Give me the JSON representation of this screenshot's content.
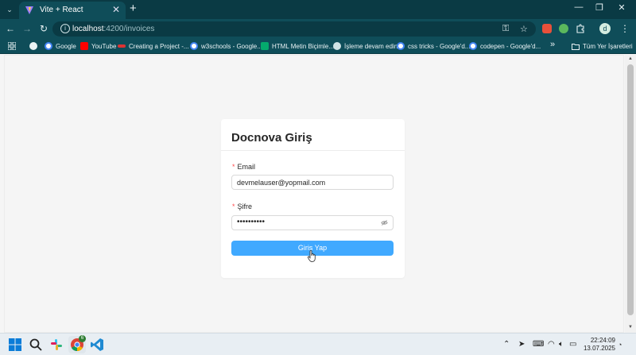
{
  "tab": {
    "title": "Vite + React",
    "close": "✕"
  },
  "new_tab": "+",
  "window": {
    "minimize": "—",
    "restore": "❐",
    "close": "✕"
  },
  "address": {
    "host": "localhost",
    "path": ":4200/invoices"
  },
  "bookmarks": [
    {
      "label": "Google",
      "icon": "google-icon",
      "color": "#4285f4"
    },
    {
      "label": "YouTube",
      "icon": "youtube-icon",
      "color": "#ff0000"
    },
    {
      "label": "Creating a Project -...",
      "icon": "angular-icon",
      "color": "#dd3333"
    },
    {
      "label": "w3schools - Google...",
      "icon": "google-icon",
      "color": "#4285f4"
    },
    {
      "label": "HTML Metin Biçimle...",
      "icon": "w3-icon",
      "color": "#04aa6d"
    },
    {
      "label": "İşleme devam edin.",
      "icon": "globe-icon",
      "color": "#cfe3e6"
    },
    {
      "label": "css tricks - Google'd...",
      "icon": "google-icon",
      "color": "#4285f4"
    },
    {
      "label": "codepen - Google'd...",
      "icon": "google-icon",
      "color": "#4285f4"
    }
  ],
  "bookmarks_overflow": "»",
  "all_bookmarks": "Tüm Yer İşaretleri",
  "profile_initial": "d",
  "login": {
    "title": "Docnova Giriş",
    "email_label": "Email",
    "email_value": "devmelauser@yopmail.com",
    "password_label": "Şifre",
    "password_value": "••••••••••",
    "required_mark": "*",
    "submit_label": "Giriş Yap"
  },
  "taskbar": {
    "time": "22:24:09",
    "date": "13.07.2025",
    "chrome_badge": "6"
  },
  "colors": {
    "primary": "#40a9ff",
    "chrome_frame": "#0f4d59",
    "required": "#ff4d4f"
  }
}
